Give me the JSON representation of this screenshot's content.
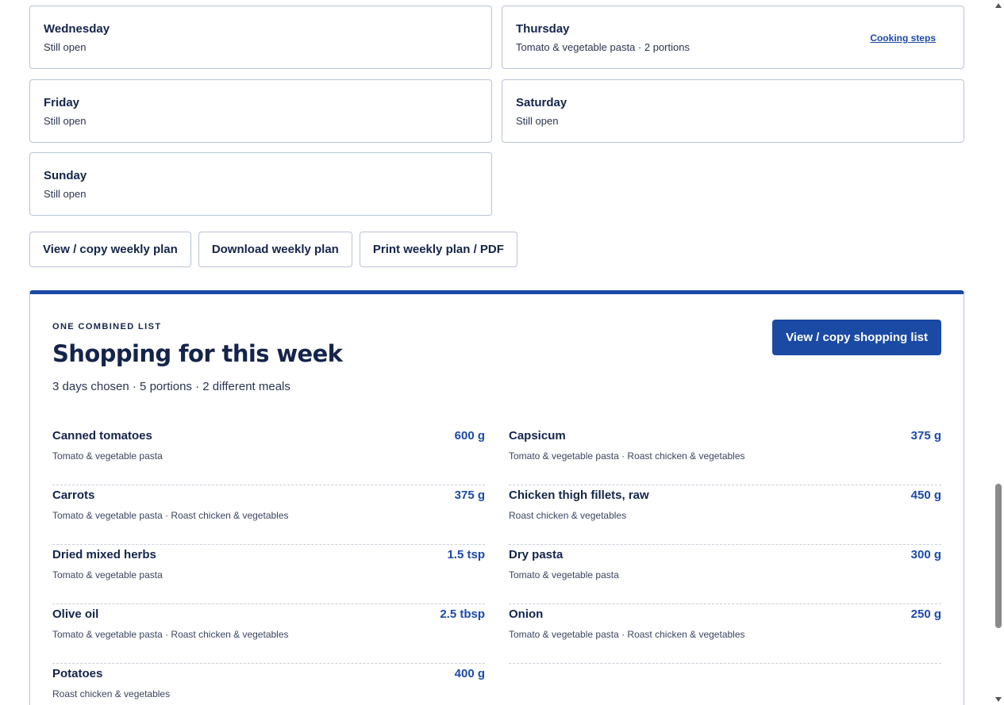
{
  "days": [
    {
      "name": "Wednesday",
      "status": "Still open",
      "link": ""
    },
    {
      "name": "Thursday",
      "status": "Tomato & vegetable pasta · 2 portions",
      "link": "Cooking steps"
    },
    {
      "name": "Friday",
      "status": "Still open",
      "link": ""
    },
    {
      "name": "Saturday",
      "status": "Still open",
      "link": ""
    },
    {
      "name": "Sunday",
      "status": "Still open",
      "link": ""
    }
  ],
  "plan_actions": {
    "view_copy": "View / copy weekly plan",
    "download": "Download weekly plan",
    "print": "Print weekly plan / PDF"
  },
  "shopping": {
    "eyebrow": "ONE COMBINED LIST",
    "title": "Shopping for this week",
    "summary": "3 days chosen · 5 portions · 2 different meals",
    "copy_button": "View / copy shopping list",
    "items": [
      {
        "name": "Canned tomatoes",
        "qty": "600 g",
        "sources": "Tomato & vegetable pasta"
      },
      {
        "name": "Capsicum",
        "qty": "375 g",
        "sources": "Tomato & vegetable pasta · Roast chicken & vegetables"
      },
      {
        "name": "Carrots",
        "qty": "375 g",
        "sources": "Tomato & vegetable pasta · Roast chicken & vegetables"
      },
      {
        "name": "Chicken thigh fillets, raw",
        "qty": "450 g",
        "sources": "Roast chicken & vegetables"
      },
      {
        "name": "Dried mixed herbs",
        "qty": "1.5 tsp",
        "sources": "Tomato & vegetable pasta"
      },
      {
        "name": "Dry pasta",
        "qty": "300 g",
        "sources": "Tomato & vegetable pasta"
      },
      {
        "name": "Olive oil",
        "qty": "2.5 tbsp",
        "sources": "Tomato & vegetable pasta · Roast chicken & vegetables"
      },
      {
        "name": "Onion",
        "qty": "250 g",
        "sources": "Tomato & vegetable pasta · Roast chicken & vegetables"
      },
      {
        "name": "Potatoes",
        "qty": "400 g",
        "sources": "Roast chicken & vegetables"
      }
    ]
  },
  "colors": {
    "accent": "#1b4aa5",
    "text_dark": "#14244a",
    "border": "#b9c3d6"
  }
}
